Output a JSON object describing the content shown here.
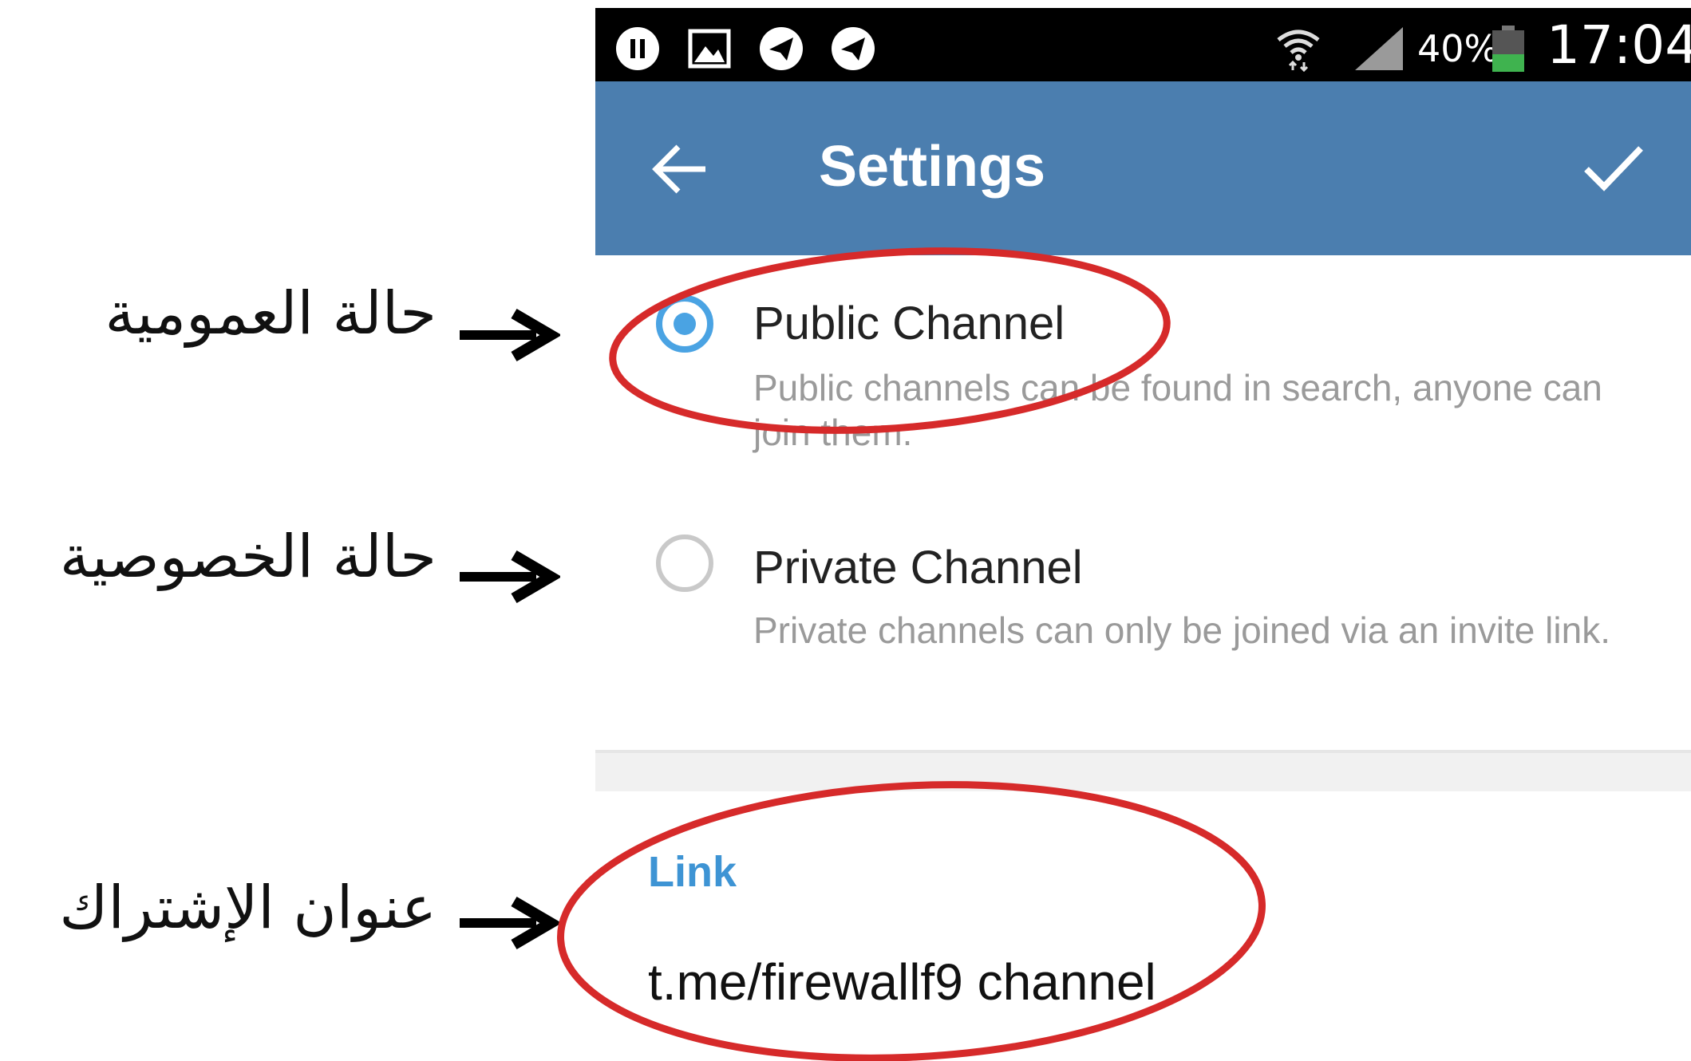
{
  "status_bar": {
    "battery_percent": "40%",
    "time": "17:04",
    "icons": [
      "pause-icon",
      "image-icon",
      "telegram-icon",
      "telegram-icon",
      "wifi-icon",
      "signal-icon",
      "battery-icon"
    ]
  },
  "toolbar": {
    "title": "Settings",
    "back_icon": "arrow-left-icon",
    "confirm_icon": "check-icon",
    "color": "#4b7eaf"
  },
  "options": {
    "public": {
      "title": "Public Channel",
      "description": "Public channels can be found in search, anyone can join them.",
      "selected": true
    },
    "private": {
      "title": "Private Channel",
      "description": "Private channels can only be joined via an invite link.",
      "selected": false
    }
  },
  "link": {
    "label": "Link",
    "value": "t.me/firewallf9 channel"
  },
  "annotations": {
    "public": "حالة العمومية",
    "private": "حالة الخصوصية",
    "link": "عنوان الإشتراك"
  },
  "colors": {
    "accent": "#4aa3e3",
    "highlight_ellipse": "#d62a2a"
  }
}
